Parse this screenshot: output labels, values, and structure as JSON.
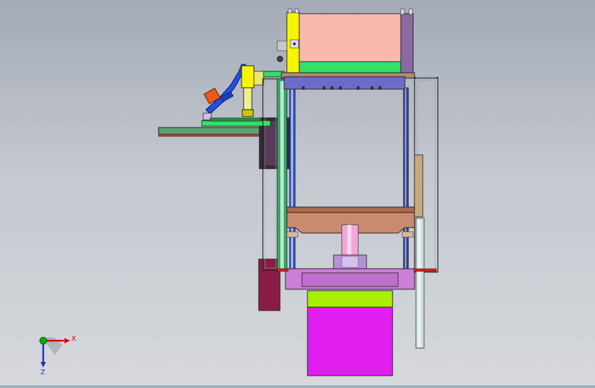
{
  "view": {
    "background_top": "#a4abb6",
    "background_bottom": "#d6d8dc"
  },
  "triad": {
    "x_label": "X",
    "z_label": "Z",
    "x_color": "#e00000",
    "y_color": "#00b000",
    "z_color": "#2030c0"
  },
  "colors": {
    "upper_box": "#fbb8ac",
    "green_plate": "#33e06a",
    "yellow_post": "#f5f500",
    "blue_beam": "#6c6cc8",
    "brown_platen": "#c98a6e",
    "pink_cylinder": "#f3a6d8",
    "lilac_base": "#cc7fd8",
    "lime_block": "#a8f000",
    "magenta_block": "#e01ef0",
    "maroon_block": "#8a1d47",
    "orange_part": "#e85a1a",
    "feeder_blue": "#2050e0",
    "table_green": "#5fa070"
  }
}
